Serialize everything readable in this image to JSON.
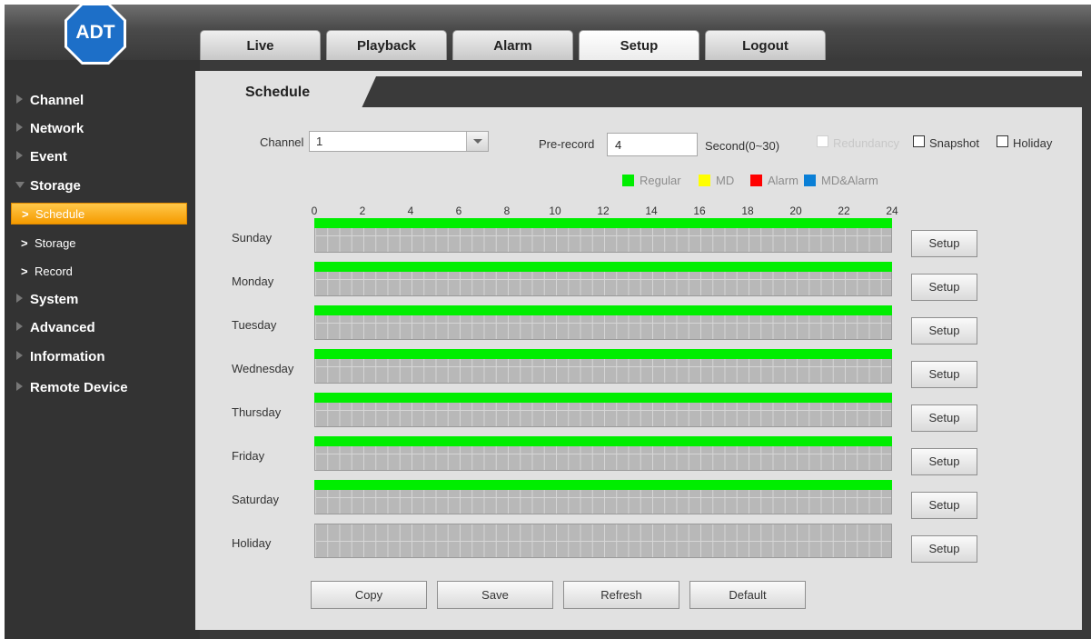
{
  "brand": {
    "logo_text": "ADT",
    "logo_color": "#1d6fc8"
  },
  "topnav": {
    "tabs": [
      {
        "label": "Live"
      },
      {
        "label": "Playback"
      },
      {
        "label": "Alarm"
      },
      {
        "label": "Setup",
        "active": true
      },
      {
        "label": "Logout"
      }
    ]
  },
  "sidebar": {
    "items": [
      {
        "label": "Channel",
        "expanded": false
      },
      {
        "label": "Network",
        "expanded": false
      },
      {
        "label": "Event",
        "expanded": false
      },
      {
        "label": "Storage",
        "expanded": true
      },
      {
        "label": "System",
        "expanded": false
      },
      {
        "label": "Advanced",
        "expanded": false
      },
      {
        "label": "Information",
        "expanded": false
      },
      {
        "label": "Remote Device",
        "expanded": false
      }
    ],
    "storage_sub": [
      {
        "label": "Schedule",
        "active": true
      },
      {
        "label": "Storage"
      },
      {
        "label": "Record"
      }
    ]
  },
  "content_tab": "Schedule",
  "form": {
    "channel_label": "Channel",
    "channel_value": "1",
    "prerecord_label": "Pre-record",
    "prerecord_value": "4",
    "second_label": "Second(0~30)",
    "redundancy_label": "Redundancy",
    "snapshot_label": "Snapshot",
    "holiday_label": "Holiday"
  },
  "legend": [
    {
      "label": "Regular",
      "color": "#00ee00"
    },
    {
      "label": "MD",
      "color": "#ffff00"
    },
    {
      "label": "Alarm",
      "color": "#ff0000"
    },
    {
      "label": "MD&Alarm",
      "color": "#0a7fd6"
    }
  ],
  "timeline": {
    "ticks": [
      "0",
      "2",
      "4",
      "6",
      "8",
      "10",
      "12",
      "14",
      "16",
      "18",
      "20",
      "22",
      "24"
    ]
  },
  "days": [
    {
      "label": "Sunday",
      "regular": [
        0,
        24
      ]
    },
    {
      "label": "Monday",
      "regular": [
        0,
        24
      ]
    },
    {
      "label": "Tuesday",
      "regular": [
        0,
        24
      ]
    },
    {
      "label": "Wednesday",
      "regular": [
        0,
        24
      ]
    },
    {
      "label": "Thursday",
      "regular": [
        0,
        24
      ]
    },
    {
      "label": "Friday",
      "regular": [
        0,
        24
      ]
    },
    {
      "label": "Saturday",
      "regular": [
        0,
        24
      ]
    },
    {
      "label": "Holiday",
      "regular": null
    }
  ],
  "setup_label": "Setup",
  "buttons": {
    "copy": "Copy",
    "save": "Save",
    "refresh": "Refresh",
    "default": "Default"
  }
}
